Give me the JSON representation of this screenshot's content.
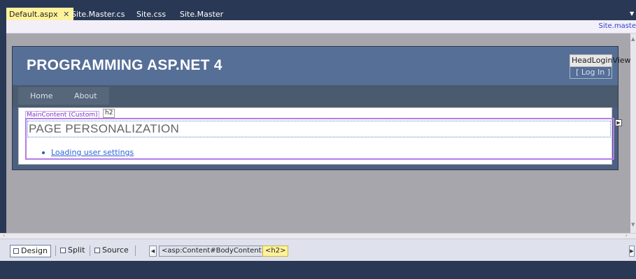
{
  "tabs": [
    {
      "label": "Default.aspx",
      "active": true,
      "close_icon": "✕"
    },
    {
      "label": "Site.Master.cs",
      "active": false
    },
    {
      "label": "Site.css",
      "active": false
    },
    {
      "label": "Site.Master",
      "active": false
    }
  ],
  "master_link": "Site.maste",
  "page": {
    "site_title": "PROGRAMMING ASP.NET 4",
    "login_view_label": "HeadLoginView",
    "login_link": "[ Log In ]",
    "menu": [
      "Home",
      "About"
    ],
    "content_tag": "MainContent (Custom)",
    "h2_tag": "h2",
    "heading": "PAGE PERSONALIZATION",
    "list_items": [
      "Loading user settings"
    ]
  },
  "bottom_bar": {
    "views": [
      "Design",
      "Split",
      "Source"
    ],
    "active_view": "Design",
    "breadcrumbs": [
      "<asp:Content#BodyContent>",
      "<h2>"
    ],
    "current_crumb": "<h2>"
  },
  "colors": {
    "tab_active": "#fff29d",
    "header_bg": "#566f97",
    "menu_bg": "#4a5a6f",
    "content_region_border": "#b27de8",
    "link": "#2f64d8"
  }
}
